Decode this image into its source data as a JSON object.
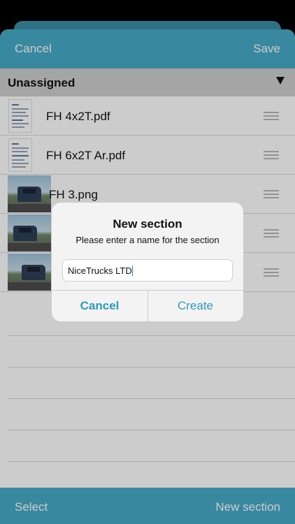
{
  "navbar": {
    "cancel_label": "Cancel",
    "save_label": "Save"
  },
  "section": {
    "title": "Unassigned",
    "arrow_icon": "triangle-down-icon"
  },
  "files": [
    {
      "name": "FH 4x2T.pdf",
      "thumb": "pdf-thumbnail"
    },
    {
      "name": "FH 6x2T Ar.pdf",
      "thumb": "pdf-thumbnail"
    },
    {
      "name": "FH 3.png",
      "thumb": "truck-photo"
    },
    {
      "name": "",
      "thumb": "truck-photo"
    },
    {
      "name": "",
      "thumb": "truck-photo"
    }
  ],
  "tabbar": {
    "select_label": "Select",
    "new_section_label": "New section"
  },
  "dialog": {
    "title": "New section",
    "message": "Please enter a name for the section",
    "input_value": "NiceTrucks LTD",
    "cancel_label": "Cancel",
    "create_label": "Create"
  },
  "colors": {
    "accent": "#47abc7",
    "dialog_button": "#2d9bbd"
  }
}
